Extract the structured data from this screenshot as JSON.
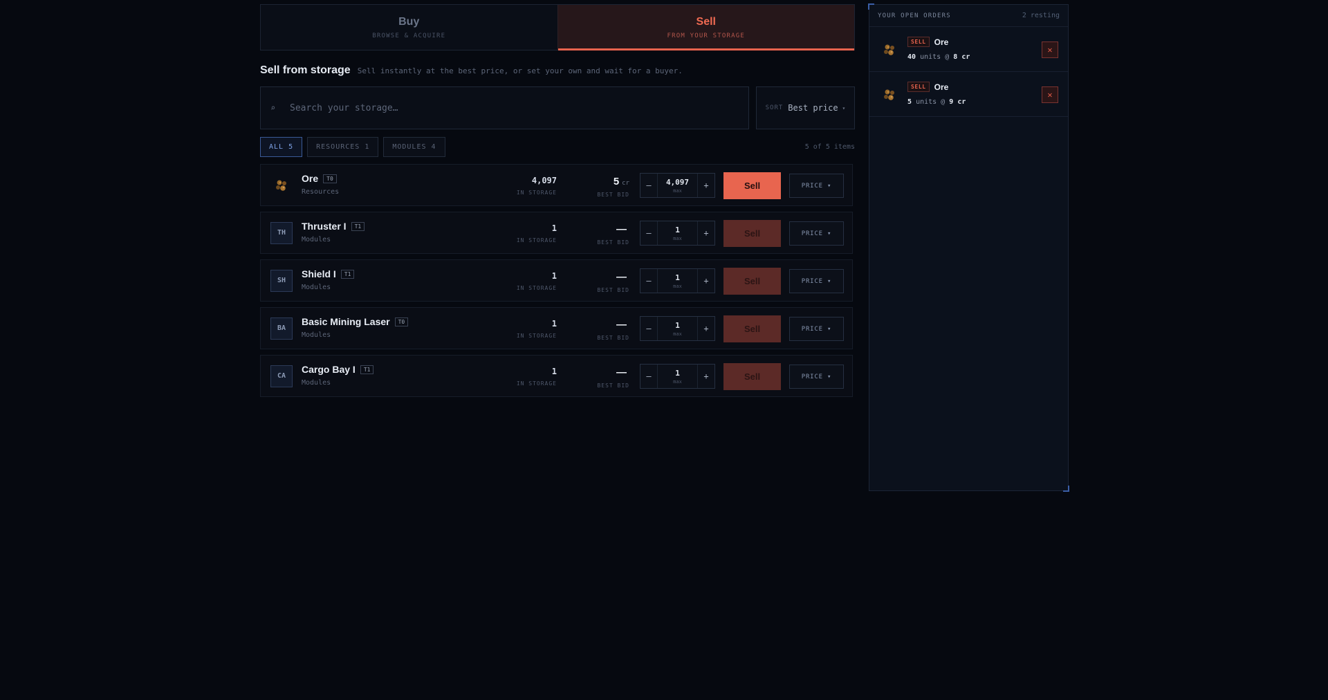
{
  "tabs": [
    {
      "title": "Buy",
      "subtitle": "BROWSE & ACQUIRE",
      "active": false
    },
    {
      "title": "Sell",
      "subtitle": "FROM YOUR STORAGE",
      "active": true
    }
  ],
  "section": {
    "title": "Sell from storage",
    "subtitle": "Sell instantly at the best price, or set your own and wait for a buyer."
  },
  "search": {
    "icon": "search-icon",
    "placeholder": "Search your storage…"
  },
  "sort": {
    "label": "SORT",
    "value": "Best price",
    "caret": "▾"
  },
  "filters": [
    {
      "label": "ALL 5",
      "active": true
    },
    {
      "label": "RESOURCES 1",
      "active": false
    },
    {
      "label": "MODULES 4",
      "active": false
    }
  ],
  "items_count": "5 of 5 items",
  "labels": {
    "in_storage": "IN STORAGE",
    "best_bid": "BEST BID",
    "max": "max",
    "sell": "Sell",
    "price": "PRICE ▾",
    "minus": "–",
    "plus": "+",
    "cr": "cr"
  },
  "items": [
    {
      "name": "Ore",
      "tier": "T0",
      "category": "Resources",
      "icon": "ore-icon",
      "abbr": "",
      "storage": "4,097",
      "best_bid": "5",
      "bid_unit": "cr",
      "qty": "4,097",
      "sell_enabled": true
    },
    {
      "name": "Thruster I",
      "tier": "T1",
      "category": "Modules",
      "icon": "",
      "abbr": "TH",
      "storage": "1",
      "best_bid": "—",
      "bid_unit": "",
      "qty": "1",
      "sell_enabled": false
    },
    {
      "name": "Shield I",
      "tier": "T1",
      "category": "Modules",
      "icon": "",
      "abbr": "SH",
      "storage": "1",
      "best_bid": "—",
      "bid_unit": "",
      "qty": "1",
      "sell_enabled": false
    },
    {
      "name": "Basic Mining Laser",
      "tier": "T0",
      "category": "Modules",
      "icon": "",
      "abbr": "BA",
      "storage": "1",
      "best_bid": "—",
      "bid_unit": "",
      "qty": "1",
      "sell_enabled": false
    },
    {
      "name": "Cargo Bay I",
      "tier": "T1",
      "category": "Modules",
      "icon": "",
      "abbr": "CA",
      "storage": "1",
      "best_bid": "—",
      "bid_unit": "",
      "qty": "1",
      "sell_enabled": false
    }
  ],
  "orders": {
    "title": "YOUR OPEN ORDERS",
    "count": "2 resting",
    "list": [
      {
        "side": "SELL",
        "name": "Ore",
        "icon": "ore-icon",
        "qty": "40",
        "price": "8",
        "units_word": "units @",
        "unit": "cr",
        "cancel": "✕"
      },
      {
        "side": "SELL",
        "name": "Ore",
        "icon": "ore-icon",
        "qty": "5",
        "price": "9",
        "units_word": "units @",
        "unit": "cr",
        "cancel": "✕"
      }
    ]
  },
  "colors": {
    "accent": "#e8654f",
    "accent_dim": "#5c2a27",
    "filter_active": "#7ea2e6",
    "background": "#060910"
  }
}
